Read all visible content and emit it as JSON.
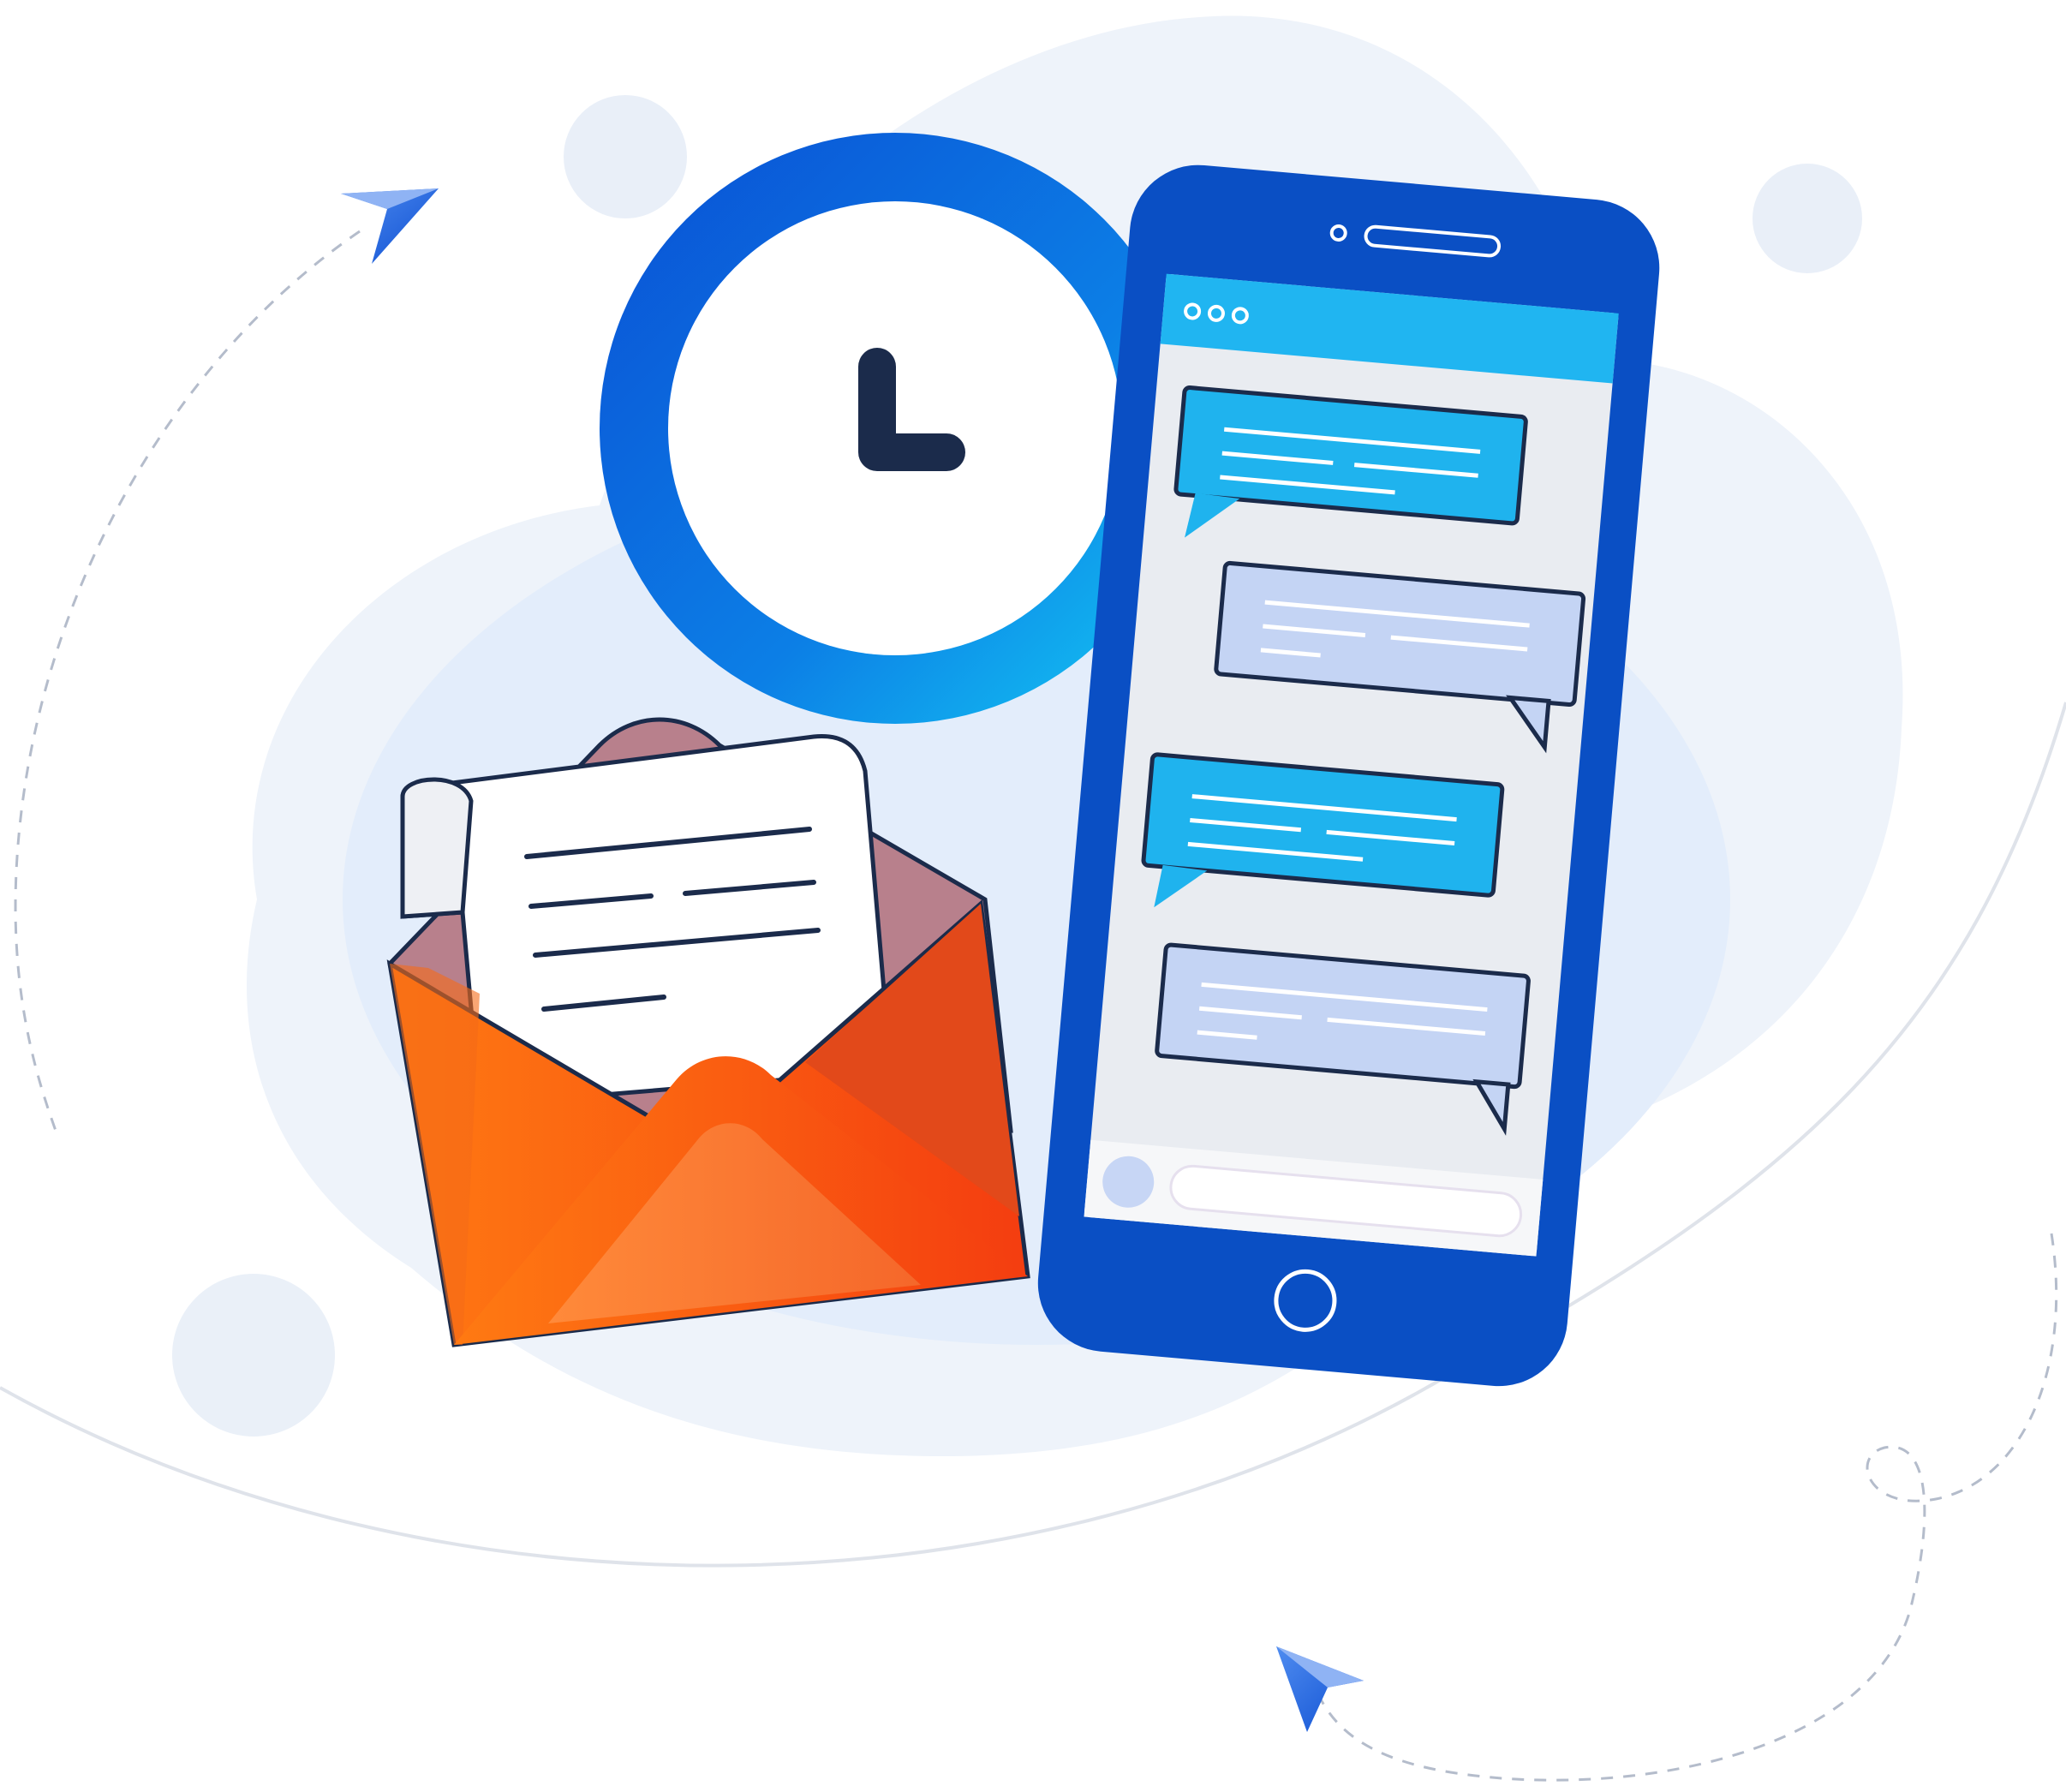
{
  "illustration": {
    "colors": {
      "background": "#ffffff",
      "cloud": "#eef3fa",
      "cloud_inner": "#e2edfb",
      "phone_body": "#0a4fc4",
      "phone_screen": "#e8ebf0",
      "phone_header": "#1fb6f2",
      "bubble_blue": "#19b3ef",
      "bubble_lavender": "#c4d4f4",
      "outline": "#1b2b4b",
      "clock_ring_start": "#0a55d6",
      "clock_ring_end": "#12c8f2",
      "envelope_orange": "#ff6a10",
      "envelope_red": "#f04a12",
      "envelope_inner": "#b8808c",
      "letter": "#ffffff",
      "paper_plane": "#1a63e0",
      "dashed_path": "#b4bccb",
      "orbit": "#dfe3ea",
      "dot": "#e9eff8"
    },
    "icons": [
      "clock-icon",
      "envelope-icon",
      "letter-icon",
      "smartphone-icon",
      "chat-bubble-icon",
      "paper-plane-icon"
    ]
  }
}
